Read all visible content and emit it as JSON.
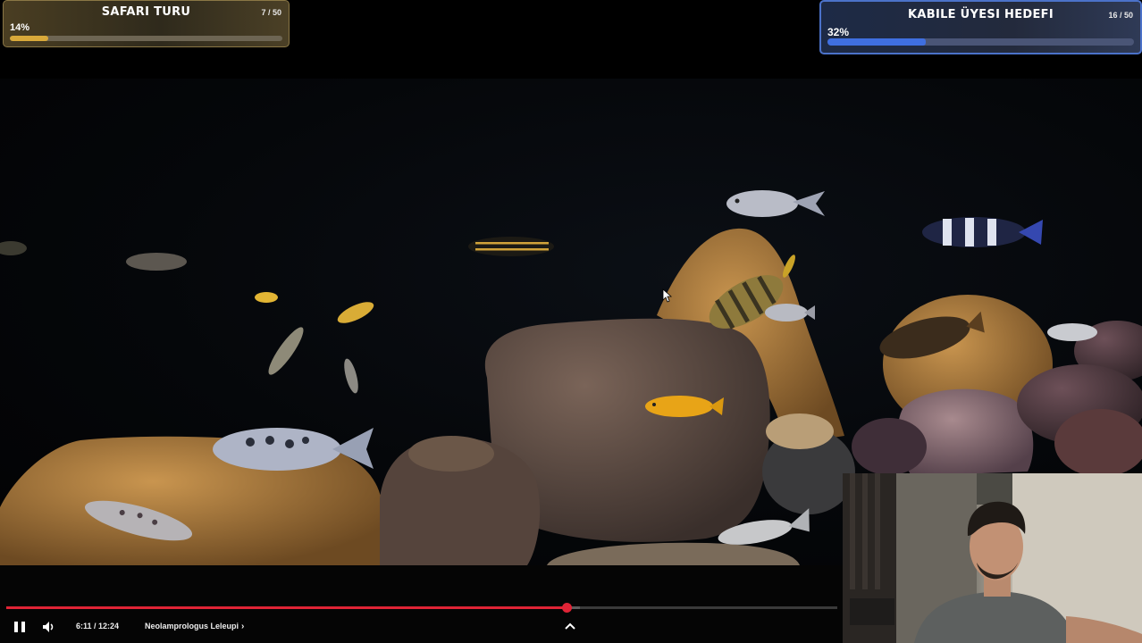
{
  "goals": {
    "safari": {
      "title": "SAFARI TURU",
      "count": "7 / 50",
      "percent_label": "14%",
      "progress": 0.14,
      "accent": "#d9a93a"
    },
    "kabile": {
      "title": "KABILE ÜYESI HEDEFI",
      "count": "16 / 50",
      "percent_label": "32%",
      "progress": 0.32,
      "accent": "#3f6fe0"
    }
  },
  "player": {
    "time": "6:11 / 12:24",
    "chapter": "Neolamprologus Leleupi",
    "chapter_chevron": "›",
    "progress": 0.674,
    "buffered": 0.69,
    "accent": "#e02436",
    "icons": {
      "play_state": "pause-icon",
      "volume": "volume-icon",
      "expand": "chevron-up-icon"
    }
  }
}
